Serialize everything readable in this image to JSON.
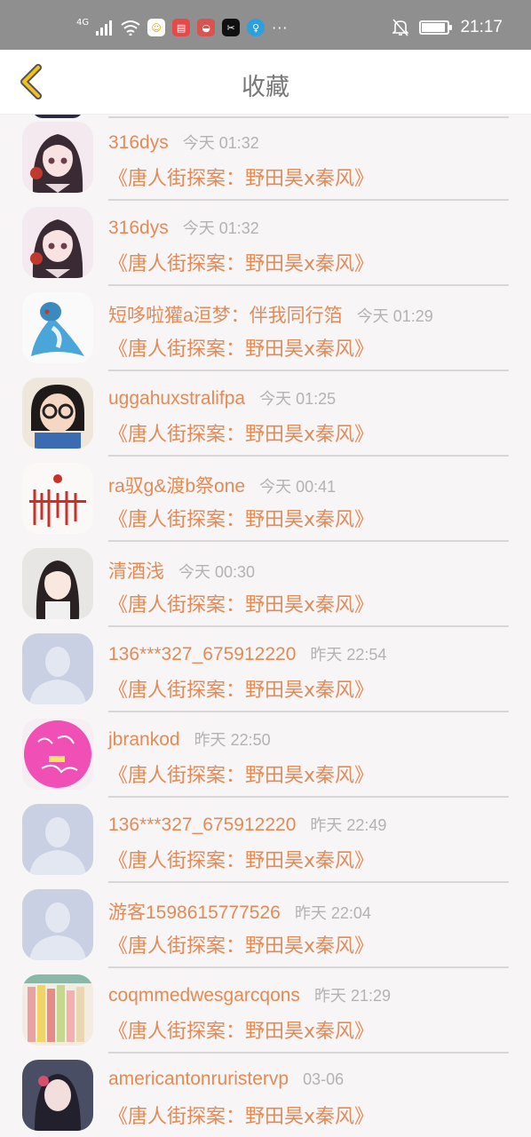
{
  "status_bar": {
    "network": "4G",
    "time": "21:17",
    "battery_level": 0.9,
    "icons": [
      "signal-icon",
      "wifi-icon",
      "app-icon-1",
      "app-icon-2",
      "app-icon-3",
      "app-icon-capcut",
      "app-icon-lightbulb",
      "more-dots-icon",
      "mute-bell-icon",
      "battery-icon"
    ]
  },
  "header": {
    "title": "收藏",
    "back_icon": "chevron-left-icon"
  },
  "items": [
    {
      "name": "316dys",
      "time": "今天 01:32",
      "title": "《唐人街探案：野田昊x秦风》",
      "avatar": "anime-girl"
    },
    {
      "name": "316dys",
      "time": "今天 01:32",
      "title": "《唐人街探案：野田昊x秦风》",
      "avatar": "anime-girl"
    },
    {
      "name": "短哆啦獾a洹梦：伴我同行箔",
      "time": "今天 01:29",
      "title": "《唐人街探案：野田昊x秦风》",
      "avatar": "blue-pokemon"
    },
    {
      "name": "uggahuxstralifpa",
      "time": "今天 01:25",
      "title": "《唐人街探案：野田昊x秦风》",
      "avatar": "child-glasses"
    },
    {
      "name": "ra驭g&渡b祭one",
      "time": "今天 00:41",
      "title": "《唐人街探案：野田昊x秦风》",
      "avatar": "text-logo"
    },
    {
      "name": "清酒浅",
      "time": "今天 00:30",
      "title": "《唐人街探案：野田昊x秦风》",
      "avatar": "girl-photo"
    },
    {
      "name": "136***327_675912220",
      "time": "昨天 22:54",
      "title": "《唐人街探案：野田昊x秦风》",
      "avatar": "default"
    },
    {
      "name": "jbrankod",
      "time": "昨天 22:50",
      "title": "《唐人街探案：野田昊x秦风》",
      "avatar": "pink-circle"
    },
    {
      "name": "136***327_675912220",
      "time": "昨天 22:49",
      "title": "《唐人街探案：野田昊x秦风》",
      "avatar": "default"
    },
    {
      "name": "游客1598615777526",
      "time": "昨天 22:04",
      "title": "《唐人街探案：野田昊x秦风》",
      "avatar": "default"
    },
    {
      "name": "coqmmedwesgarcqons",
      "time": "昨天 21:29",
      "title": "《唐人街探案：野田昊x秦风》",
      "avatar": "books"
    },
    {
      "name": "americantonruristervp",
      "time": "03-06",
      "title": "《唐人街探案：野田昊x秦风》",
      "avatar": "girl-dark"
    }
  ],
  "colors": {
    "accent": "#e38b57",
    "time_gray": "#b3b3b3",
    "status_bar": "#8f8f8f",
    "back_icon_yellow": "#f2c21b"
  }
}
